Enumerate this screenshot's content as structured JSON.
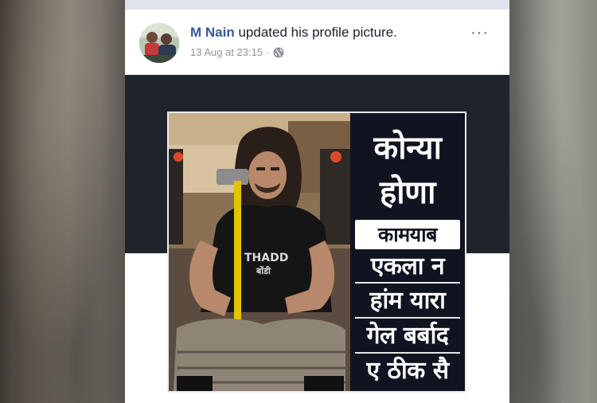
{
  "post": {
    "author": "M Nain",
    "action": "updated his profile picture.",
    "date": "13 Aug at 23:15 ·",
    "more_label": "···",
    "avatar": "profile-avatar",
    "privacy_icon": "globe-icon"
  },
  "photo": {
    "lines": [
      "कोन्या",
      "होणा",
      "कामयाब",
      "एकला न",
      "हांम यारा",
      "गेल बर्बाद",
      "ए ठीक सै"
    ],
    "shirt_text_1": "THADD",
    "shirt_text_2": "बोंडी"
  },
  "colors": {
    "author": "#385898",
    "panel": "#0f1420",
    "photo_area": "#1f232b"
  }
}
